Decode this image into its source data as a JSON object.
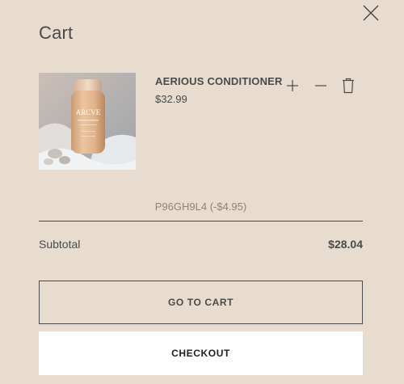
{
  "cart": {
    "title": "Cart",
    "close_icon": "close-icon"
  },
  "item": {
    "name": "AERIOUS CONDITIONER",
    "price": "$32.99",
    "image_brand_text": "ARCVE",
    "icons": [
      "plus-icon",
      "minus-icon",
      "trash-icon"
    ]
  },
  "discount": {
    "text": "P96GH9L4 (-$4.95)"
  },
  "summary": {
    "subtotal_label": "Subtotal",
    "subtotal_value": "$28.04"
  },
  "actions": {
    "go_to_cart_label": "GO TO CART",
    "checkout_label": "CHECKOUT"
  },
  "colors": {
    "background": "#e8dccf",
    "text": "#4a4a4a",
    "checkout_bg": "#ffffff"
  }
}
